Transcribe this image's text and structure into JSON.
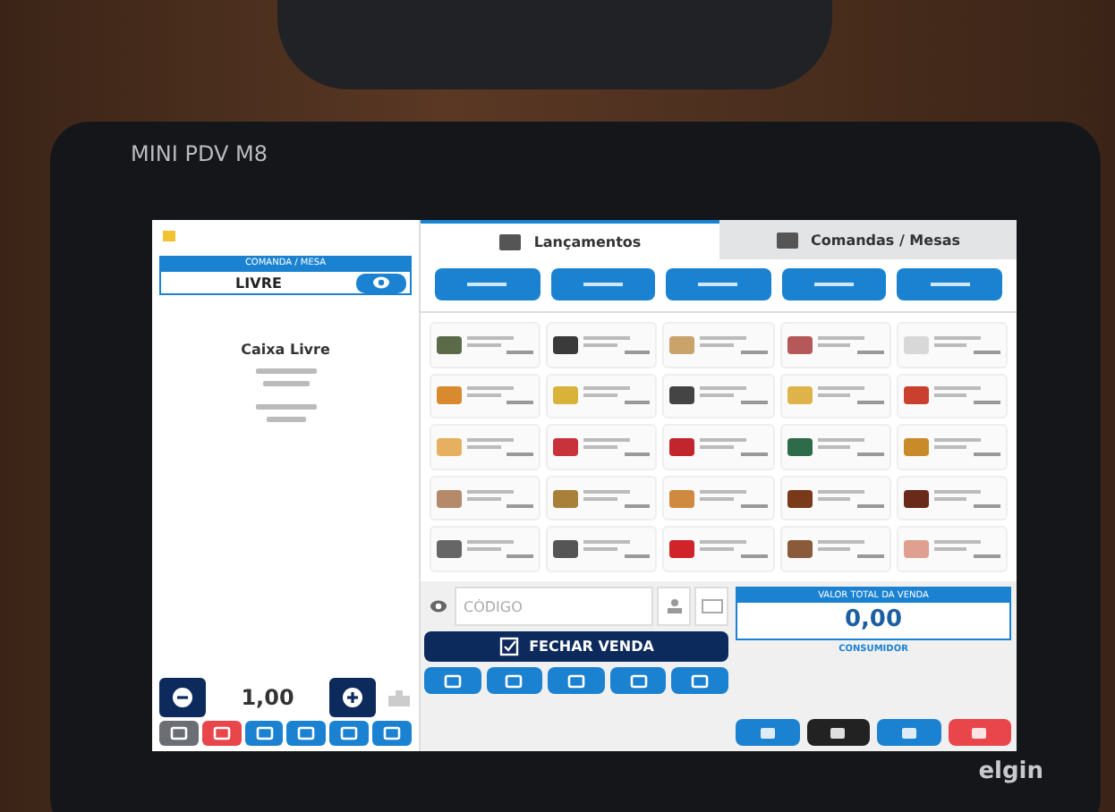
{
  "device": {
    "model": "MINI PDV M8",
    "brand": "elgin"
  },
  "left_panel": {
    "header": "COMANDA / MESA",
    "status": "LIVRE",
    "title": "Caixa Livre",
    "quantity": "1,00",
    "tool_buttons": [
      {
        "color": "#6b6f75"
      },
      {
        "color": "#e8464b"
      },
      {
        "color": "#1b82d1"
      },
      {
        "color": "#1b82d1"
      },
      {
        "color": "#1b82d1"
      },
      {
        "color": "#1b82d1"
      }
    ]
  },
  "tabs": [
    {
      "label": "Lançamentos",
      "selected": true
    },
    {
      "label": "Comandas / Mesas",
      "selected": false
    }
  ],
  "categories": [
    {
      "selected": false
    },
    {
      "selected": false
    },
    {
      "selected": false
    },
    {
      "selected": false
    },
    {
      "selected": false
    }
  ],
  "products": [
    {
      "color": "#5b6b4a"
    },
    {
      "color": "#3a3a3a"
    },
    {
      "color": "#c9a36a"
    },
    {
      "color": "#b5585a"
    },
    {
      "color": "#d8d8d8"
    },
    {
      "color": "#d98a2e"
    },
    {
      "color": "#d9b23a"
    },
    {
      "color": "#444444"
    },
    {
      "color": "#e0b34a"
    },
    {
      "color": "#c9402f"
    },
    {
      "color": "#e6b060"
    },
    {
      "color": "#c8323a"
    },
    {
      "color": "#c0262c"
    },
    {
      "color": "#2d6b4a"
    },
    {
      "color": "#c98a2a"
    },
    {
      "color": "#b58a6a"
    },
    {
      "color": "#a8803a"
    },
    {
      "color": "#d08a40"
    },
    {
      "color": "#7a3a1a"
    },
    {
      "color": "#6a2a1a"
    },
    {
      "color": "#666666"
    },
    {
      "color": "#555555"
    },
    {
      "color": "#d0242a"
    },
    {
      "color": "#8a5a3a"
    },
    {
      "color": "#e0a090"
    }
  ],
  "sale": {
    "code_placeholder": "CÓDIGO",
    "close_button": "FECHAR VENDA",
    "total_label": "VALOR TOTAL DA VENDA",
    "total": "0,00",
    "customer": "CONSUMIDOR",
    "tool_buttons": [
      {
        "color": "#1b82d1"
      },
      {
        "color": "#1b82d1"
      },
      {
        "color": "#1b82d1"
      },
      {
        "color": "#1b82d1"
      },
      {
        "color": "#1b82d1"
      }
    ],
    "action_buttons": [
      {
        "color": "#1b82d1"
      },
      {
        "color": "#222222"
      },
      {
        "color": "#1b82d1"
      },
      {
        "color": "#e8464b"
      }
    ]
  }
}
